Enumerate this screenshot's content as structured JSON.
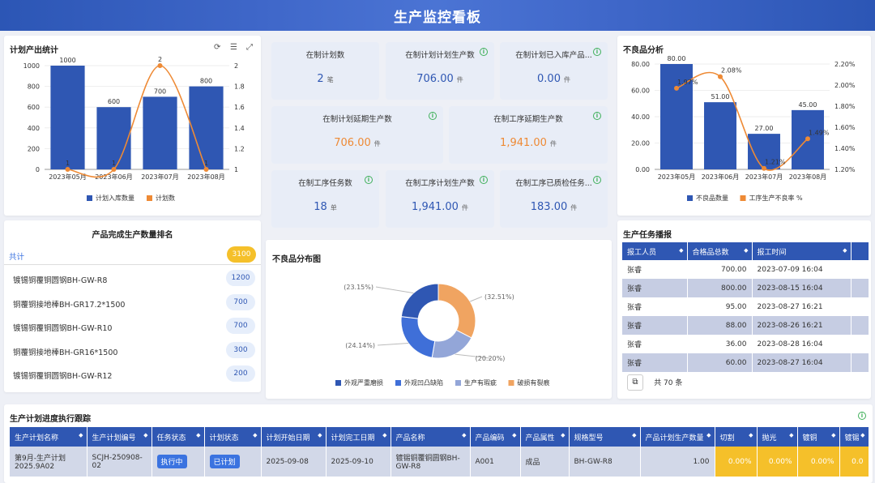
{
  "header": {
    "title": "生产监控看板"
  },
  "plan_chart": {
    "title": "计划产出统计",
    "tools": {
      "refresh": "⟳",
      "list": "☰",
      "expand": "⤢"
    },
    "legend": [
      "计划入库数量",
      "计划数"
    ]
  },
  "chart_data": [
    {
      "type": "bar",
      "title": "计划产出统计",
      "categories": [
        "2023年05月",
        "2023年06月",
        "2023年07月",
        "2023年08月"
      ],
      "series": [
        {
          "name": "计划入库数量",
          "type": "bar",
          "values": [
            1000,
            600,
            700,
            800
          ]
        },
        {
          "name": "计划数",
          "type": "line",
          "values": [
            1,
            1,
            2,
            1
          ],
          "axis": "right"
        }
      ],
      "ylim": [
        0,
        1000
      ],
      "y2lim": [
        1,
        2
      ],
      "yticks": [
        "0",
        "200",
        "400",
        "600",
        "800",
        "1000"
      ],
      "y2ticks": [
        "1",
        "1.2",
        "1.4",
        "1.6",
        "1.8",
        "2"
      ],
      "bar_labels": [
        "1000",
        "600",
        "700",
        "800"
      ],
      "line_labels": [
        "1",
        "1",
        "2",
        "1"
      ],
      "legend_position": "bottom",
      "colors": [
        "#2f57b3",
        "#ee8a35"
      ]
    },
    {
      "type": "bar",
      "title": "不良品分析",
      "categories": [
        "2023年05月",
        "2023年06月",
        "2023年07月",
        "2023年08月"
      ],
      "series": [
        {
          "name": "不良品数量",
          "type": "bar",
          "values": [
            80,
            51,
            27,
            45
          ]
        },
        {
          "name": "工序生产不良率 %",
          "type": "line",
          "values": [
            1.97,
            2.08,
            1.21,
            1.49
          ],
          "axis": "right"
        }
      ],
      "ylim": [
        0,
        80
      ],
      "y2lim": [
        1.2,
        2.2
      ],
      "yticks": [
        "0.00",
        "20.00",
        "40.00",
        "60.00",
        "80.00"
      ],
      "y2ticks": [
        "1.20%",
        "1.40%",
        "1.60%",
        "1.80%",
        "2.00%",
        "2.20%"
      ],
      "bar_labels": [
        "80.00",
        "51.00",
        "27.00",
        "45.00"
      ],
      "line_labels": [
        "1.97%",
        "2.08%",
        "1.21%",
        "1.49%"
      ],
      "legend_position": "bottom",
      "colors": [
        "#2f57b3",
        "#ee8a35"
      ]
    },
    {
      "type": "pie",
      "title": "不良品分布图",
      "labels": [
        "外观严重磨损",
        "外观凹凸缺陷",
        "生产有瑕疵",
        "破损有裂痕"
      ],
      "values": [
        23.15,
        24.14,
        20.2,
        32.51
      ],
      "value_labels": [
        "(23.15%)",
        "(24.14%)",
        "(20.20%)",
        "(32.51%)"
      ],
      "colors": [
        "#2f57b3",
        "#3f6fd8",
        "#93a6d8",
        "#f0a461"
      ],
      "legend_position": "bottom"
    }
  ],
  "kpis": [
    {
      "label": "在制计划数",
      "value": "2",
      "unit": "笔"
    },
    {
      "label": "在制计划计划生产数",
      "value": "706.00",
      "unit": "件"
    },
    {
      "label": "在制计划已入库产品...",
      "value": "0.00",
      "unit": "件"
    },
    {
      "label": "在制计划延期生产数",
      "value": "706.00",
      "unit": "件"
    },
    {
      "label": "在制工序延期生产数",
      "value": "1,941.00",
      "unit": "件"
    },
    {
      "label": "在制工序任务数",
      "value": "18",
      "unit": "单"
    },
    {
      "label": "在制工序计划生产数",
      "value": "1,941.00",
      "unit": "件"
    },
    {
      "label": "在制工序已质检任务...",
      "value": "183.00",
      "unit": "件"
    }
  ],
  "defect": {
    "title": "不良品分析"
  },
  "ranking": {
    "title": "产品完成生产数量排名",
    "total_label": "共计",
    "total_value": "3100",
    "items": [
      {
        "name": "镀锡铜覆铜圆钢BH-GW-R8",
        "value": "1200"
      },
      {
        "name": "铜覆铜接地棒BH-GR17.2*1500",
        "value": "700"
      },
      {
        "name": "镀锡铜覆铜圆钢BH-GW-R10",
        "value": "700"
      },
      {
        "name": "铜覆铜接地棒BH-GR16*1500",
        "value": "300"
      },
      {
        "name": "镀锡铜覆铜圆钢BH-GW-R12",
        "value": "200"
      }
    ]
  },
  "pie": {
    "title": "不良品分布图"
  },
  "task_report": {
    "title": "生产任务播报",
    "columns": [
      "报工人员",
      "合格品总数",
      "报工时间"
    ],
    "rows": [
      [
        "张睿",
        "700.00",
        "2023-07-09 16:04"
      ],
      [
        "张睿",
        "800.00",
        "2023-08-15 16:04"
      ],
      [
        "张睿",
        "95.00",
        "2023-08-27 16:21"
      ],
      [
        "张睿",
        "88.00",
        "2023-08-26 16:21"
      ],
      [
        "张睿",
        "36.00",
        "2023-08-28 16:04"
      ],
      [
        "张睿",
        "60.00",
        "2023-08-27 16:04"
      ]
    ],
    "total": "共 70 条",
    "page_icon": "⧉"
  },
  "progress": {
    "title": "生产计划进度执行跟踪",
    "columns": [
      "生产计划名称",
      "生产计划编号",
      "任务状态",
      "计划状态",
      "计划开始日期",
      "计划完工日期",
      "产品名称",
      "产品编码",
      "产品属性",
      "规格型号",
      "产品计划生产数量",
      "切割",
      "抛光",
      "镀铜",
      "镀锡"
    ],
    "row": {
      "name": "第9月-生产计划2025.9A02",
      "code": "SCJH-250908-02",
      "task_status": "执行中",
      "plan_status": "已计划",
      "start": "2025-09-08",
      "end": "2025-09-10",
      "product": "镀锡铜覆铜圆钢BH-GW-R8",
      "pcode": "A001",
      "attr": "成品",
      "spec": "BH-GW-R8",
      "qty": "1.00",
      "p1": "0.00%",
      "p2": "0.00%",
      "p3": "0.00%",
      "p4": "0.0"
    }
  }
}
